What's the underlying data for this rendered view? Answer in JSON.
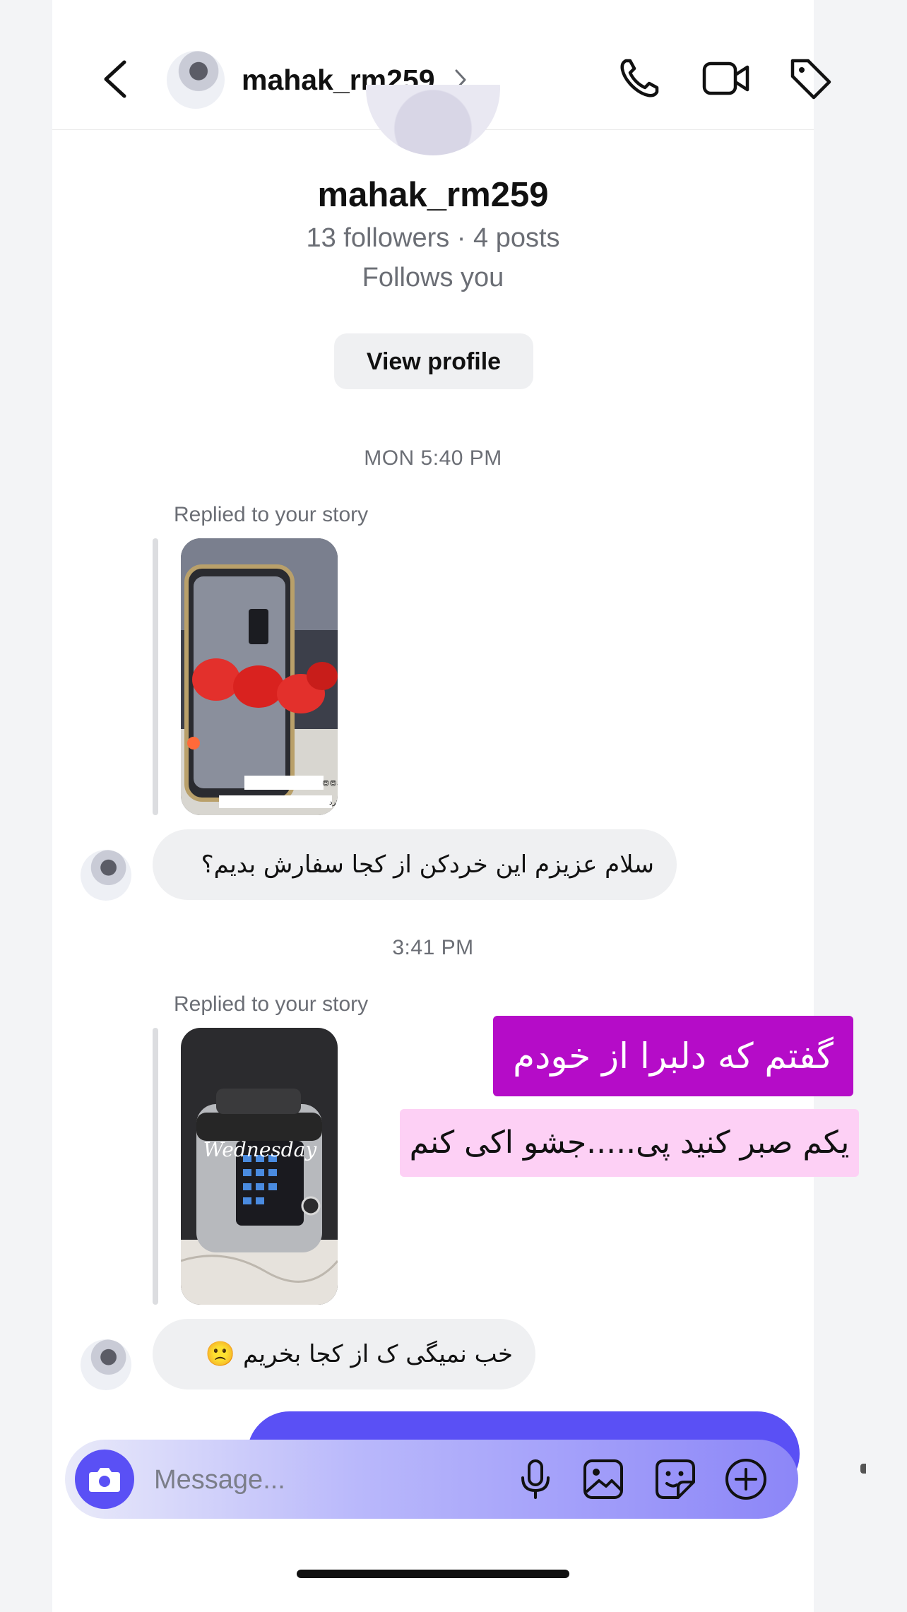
{
  "header": {
    "username": "mahak_rm259",
    "icons": [
      "back-icon",
      "chevron-right-icon",
      "phone-icon",
      "video-icon",
      "tag-icon"
    ]
  },
  "profile": {
    "name": "mahak_rm259",
    "stats": "13 followers · 4 posts",
    "follows": "Follows you",
    "view_profile_label": "View profile"
  },
  "conversation": {
    "timestamp_1": "MON 5:40 PM",
    "reply_1": {
      "label": "Replied to your story",
      "story_caption_1": "چقدر خرد کن جدیدای ویکتور خوشگله😍😍",
      "story_caption_2": "کیک تازه رو ببین چقدر فوری پودر کرد",
      "message": "سلام عزیزم این خردکن از کجا سفارش بدیم؟"
    },
    "timestamp_2": "3:41 PM",
    "reply_2": {
      "label": "Replied to your story",
      "story_text": "Wednesday",
      "message": "خب نمیگی ک از کجا بخریم 🙁"
    }
  },
  "overlays": {
    "line_1": "گفتم که دلبرا از خودم",
    "line_2": "یکم صبر کنید پی.....جشو اکی کنم"
  },
  "composer": {
    "placeholder": "Message...",
    "icons": [
      "camera-icon",
      "microphone-icon",
      "gallery-icon",
      "sticker-icon",
      "add-icon"
    ]
  },
  "colors": {
    "accent": "#5a50f5",
    "overlay_purple": "#b50cc8",
    "overlay_pink": "#fdd0f5",
    "bubble_gray": "#eff0f2"
  }
}
